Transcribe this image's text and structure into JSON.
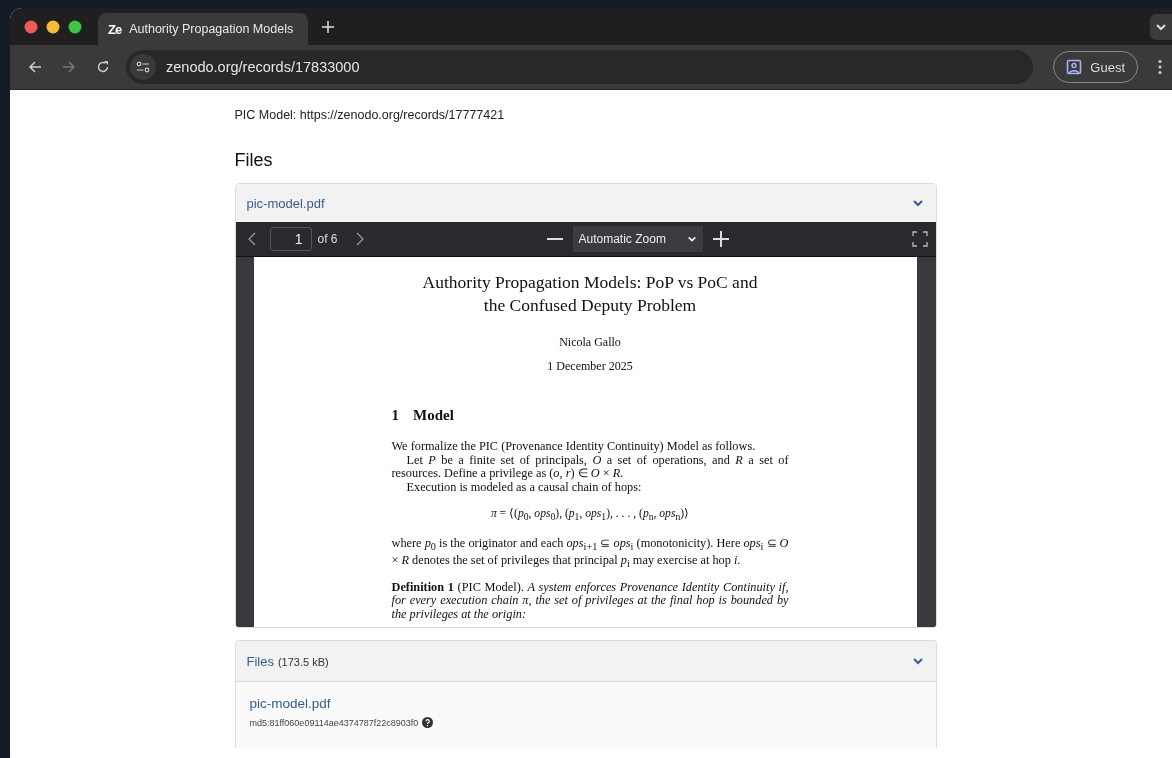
{
  "browser": {
    "tab": {
      "favicon": "Ze",
      "title": "Authority Propagation Models",
      "selected": true
    },
    "address": "zenodo.org/records/17833000",
    "profile": "Guest"
  },
  "page": {
    "intro": "PIC Model: https://zenodo.org/records/17777421",
    "heading": "Files",
    "preview": {
      "filename": "pic-model.pdf",
      "expanded": true,
      "viewer": {
        "page": "1",
        "page_count": "of 6",
        "zoom": "Automatic Zoom"
      },
      "document": {
        "title_lines": [
          "Authority Propagation Models: PoP vs PoC and",
          "the Confused Deputy Problem"
        ],
        "author": "Nicola Gallo",
        "date": "1 December 2025",
        "section_number": "1",
        "section_title": "Model",
        "blocks": [
          {
            "kind": "para",
            "indent": false,
            "text": "We formalize the PIC (Provenance Identity Continuity) Model as follows."
          },
          {
            "kind": "para",
            "indent": true,
            "text": "Let *P* be a finite set of principals, *O* a set of operations, and *R* a set of resources. Define a privilege as (*o*, *r*) ∈ *O* × *R*."
          },
          {
            "kind": "para",
            "indent": true,
            "text": "Execution is modeled as a causal chain of hops:"
          },
          {
            "kind": "equation",
            "text": "*π* = ⟨(*p*$_{0}$, *ops*$_{0}$), (*p*$_{1}$, *ops*$_{1}$), . . . , (*p*$_{n}$, *ops*$_{n}$)⟩"
          },
          {
            "kind": "para",
            "indent": false,
            "text": "where *p*$_{0}$ is the originator and each *ops*$_{i+1}$ ⊆ *ops*$_{i}$ (monotonicity). Here *ops*$_{i}$ ⊆ *O* × *R* denotes the set of privileges that principal *p*$_{i}$ may exercise at hop *i*."
          },
          {
            "kind": "definition",
            "text": "**Definition 1** (PIC Model). *A system enforces Provenance Identity Continuity if, for every execution chain π, the set of privileges at the final hop is bounded by the privileges at the origin:*"
          }
        ]
      }
    },
    "files": {
      "title": "Files",
      "size": "(173.5 kB)",
      "expanded": true,
      "items": [
        {
          "name": "pic-model.pdf",
          "checksum": "md5:81ff060e09114ae4374787f22c8903f0"
        }
      ]
    }
  }
}
